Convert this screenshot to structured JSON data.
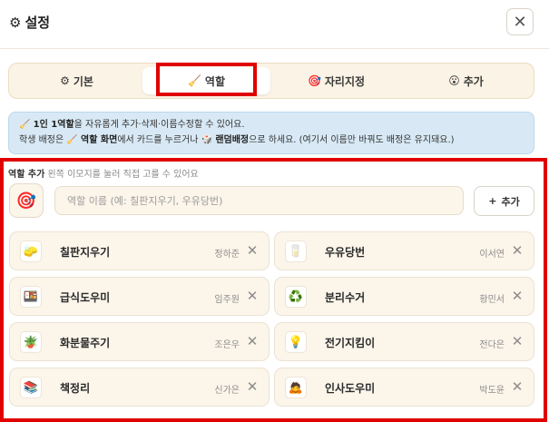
{
  "header": {
    "gear_icon": "⚙",
    "title": "설정",
    "close_icon": "✕"
  },
  "tabs": [
    {
      "icon": "⚙",
      "label": "기본",
      "active": false
    },
    {
      "icon": "🧹",
      "label": "역할",
      "active": true
    },
    {
      "icon": "🎯",
      "label": "자리지정",
      "active": false
    },
    {
      "icon": "😮",
      "label": "추가",
      "active": false
    }
  ],
  "info": {
    "line1_icon": "🧹",
    "line1_bold": "1인 1역할",
    "line1_text": "을 자유롭게 추가·삭제·이름수정할 수 있어요.",
    "line2_a": "학생 배정은",
    "line2_icon": "🧹",
    "line2_bold": "역할 화면",
    "line2_b": "에서 카드를 누르거나",
    "line2_icon2": "🎲",
    "line2_bold2": "랜덤배정",
    "line2_c": "으로 하세요. (여기서 이름만 바꿔도 배정은 유지돼요.)"
  },
  "role_add": {
    "label": "역할 추가",
    "hint": "왼쪽 이모지를 눌러 직접 고를 수 있어요",
    "emoji": "🎯",
    "placeholder": "역할 이름 (예: 칠판지우기, 우유당번)",
    "add_plus": "+",
    "add_label": "추가"
  },
  "roles": [
    {
      "icon": "🧽",
      "name": "칠판지우기",
      "student": "정하준"
    },
    {
      "icon": "🥛",
      "name": "우유당번",
      "student": "이서연"
    },
    {
      "icon": "🍱",
      "name": "급식도우미",
      "student": "임주원"
    },
    {
      "icon": "♻️",
      "name": "분리수거",
      "student": "황민서"
    },
    {
      "icon": "🪴",
      "name": "화분물주기",
      "student": "조은우"
    },
    {
      "icon": "💡",
      "name": "전기지킴이",
      "student": "전다은"
    },
    {
      "icon": "📚",
      "name": "책정리",
      "student": "신가은"
    },
    {
      "icon": "🙇",
      "name": "인사도우미",
      "student": "박도윤"
    }
  ],
  "delete_icon": "✕"
}
